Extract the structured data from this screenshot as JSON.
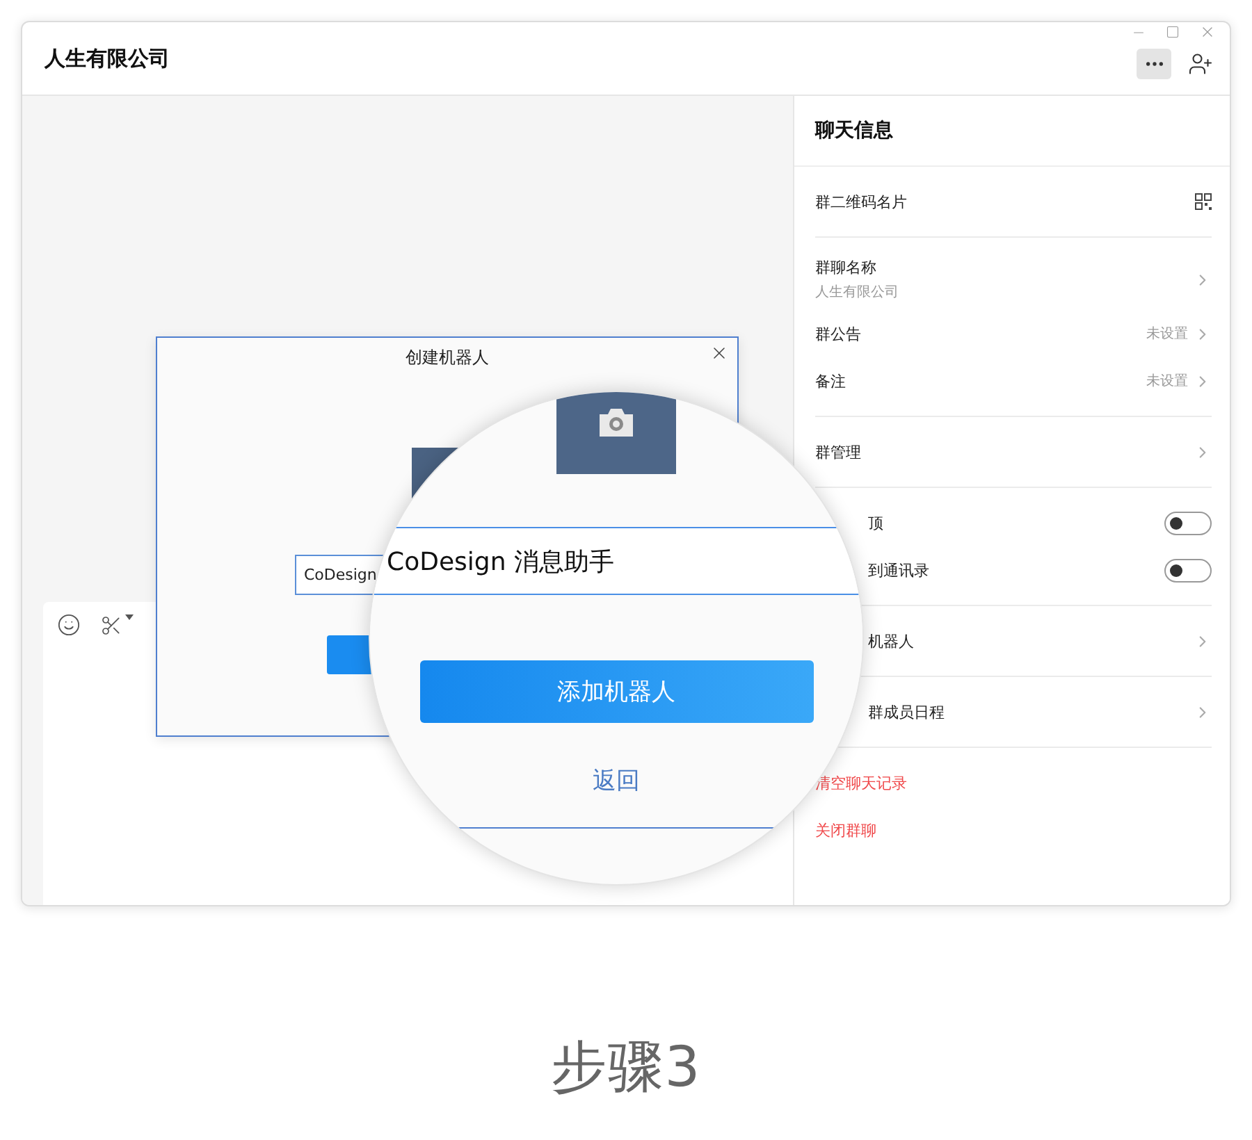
{
  "window": {
    "title": "人生有限公司"
  },
  "dialog": {
    "title": "创建机器人",
    "name_value": "CoDesign"
  },
  "magnifier": {
    "name_value": "CoDesign 消息助手",
    "primary_button": "添加机器人",
    "back_link": "返回"
  },
  "info_panel": {
    "title": "聊天信息",
    "sections": [
      [
        {
          "kind": "qr",
          "label": "群二维码名片"
        }
      ],
      [
        {
          "kind": "link",
          "label": "群聊名称",
          "sub": "人生有限公司"
        },
        {
          "kind": "link",
          "label": "群公告",
          "value": "未设置"
        },
        {
          "kind": "link",
          "label": "备注",
          "value": "未设置"
        }
      ],
      [
        {
          "kind": "link",
          "label": "群管理"
        }
      ],
      [
        {
          "kind": "toggle",
          "label": "顶",
          "on": false,
          "covered": true
        },
        {
          "kind": "toggle",
          "label": "到通讯录",
          "on": false,
          "covered": true
        }
      ],
      [
        {
          "kind": "link",
          "label": "机器人",
          "covered": true
        }
      ],
      [
        {
          "kind": "link",
          "label": "群成员日程",
          "covered": true
        }
      ],
      [
        {
          "kind": "danger",
          "label": "清空聊天记录"
        },
        {
          "kind": "danger",
          "label": "关闭群聊"
        }
      ]
    ]
  },
  "caption": "步骤3"
}
